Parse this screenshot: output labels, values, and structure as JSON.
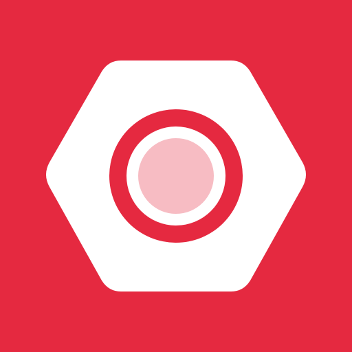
{
  "icon": {
    "name": "hex-nut-icon",
    "colors": {
      "background": "#e52940",
      "nut": "#ffffff",
      "ring": "#e52940",
      "center": "#f7bcc3"
    }
  }
}
